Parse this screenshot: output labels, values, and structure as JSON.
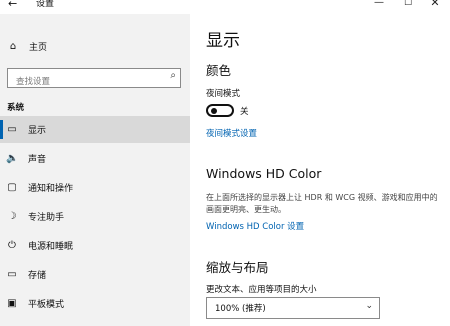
{
  "window": {
    "title": "设置",
    "back_glyph": "←",
    "minimize_glyph": "—",
    "maximize_glyph": "☐",
    "close_glyph": "✕"
  },
  "sidebar": {
    "home_label": "主页",
    "search": {
      "placeholder": "查找设置",
      "value": ""
    },
    "section_label": "系统",
    "items": [
      {
        "label": "显示",
        "icon": "monitor-icon",
        "glyph": "▭",
        "active": true
      },
      {
        "label": "声音",
        "icon": "speaker-icon",
        "glyph": "🔈",
        "active": false
      },
      {
        "label": "通知和操作",
        "icon": "notification-icon",
        "glyph": "▢",
        "active": false
      },
      {
        "label": "专注助手",
        "icon": "moon-icon",
        "glyph": "☽",
        "active": false
      },
      {
        "label": "电源和睡眠",
        "icon": "power-icon",
        "glyph": "⏻",
        "active": false
      },
      {
        "label": "存储",
        "icon": "storage-icon",
        "glyph": "▭",
        "active": false
      },
      {
        "label": "平板模式",
        "icon": "tablet-icon",
        "glyph": "▣",
        "active": false
      }
    ]
  },
  "main": {
    "page_title": "显示",
    "color_section": {
      "title": "颜色",
      "night_mode_label": "夜间模式",
      "night_mode_state": "关",
      "night_mode_on": false,
      "night_mode_settings_link": "夜间模式设置"
    },
    "hd_color_section": {
      "title": "Windows HD Color",
      "description": "在上面所选择的显示器上让 HDR 和 WCG 视频、游戏和应用中的画面更明亮、更生动。",
      "settings_link": "Windows HD Color 设置"
    },
    "scale_section": {
      "title": "缩放与布局",
      "change_label": "更改文本、应用等项目的大小",
      "dropdown_value": "100% (推荐)"
    }
  },
  "colors": {
    "accent": "#0063b1",
    "sidebar_bg": "#f2f2f2",
    "active_bg": "#d9d9d9"
  }
}
